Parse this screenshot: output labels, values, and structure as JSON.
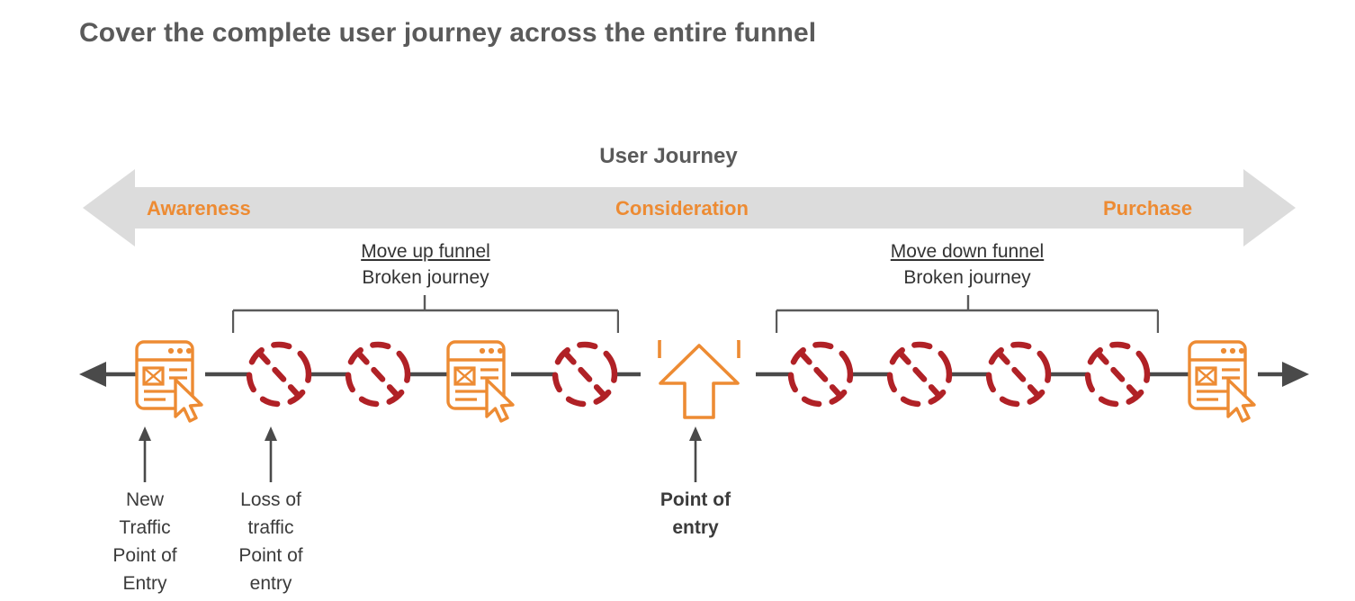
{
  "slide": {
    "title": "Cover the complete user journey across the entire funnel"
  },
  "journey": {
    "heading": "User Journey",
    "stages": [
      {
        "label": "Awareness"
      },
      {
        "label": "Consideration"
      },
      {
        "label": "Purchase"
      }
    ],
    "band_color": "#DCDCDC",
    "stage_label_color": "#ED8B33"
  },
  "brackets": [
    {
      "title": "Move up funnel",
      "subtitle": "Broken journey"
    },
    {
      "title": "Move down funnel",
      "subtitle": "Broken journey"
    }
  ],
  "timeline": {
    "line_color": "#4a4a4a",
    "webpage_icon_color": "#ED8B33",
    "broken_icon_color": "#B02126",
    "nodes": [
      {
        "type": "arrow-left-icon"
      },
      {
        "type": "webpage-cursor-icon"
      },
      {
        "type": "broken-journey-icon"
      },
      {
        "type": "broken-journey-icon"
      },
      {
        "type": "webpage-cursor-icon"
      },
      {
        "type": "broken-journey-icon"
      },
      {
        "type": "entry-point-arrow-icon"
      },
      {
        "type": "broken-journey-icon"
      },
      {
        "type": "broken-journey-icon"
      },
      {
        "type": "broken-journey-icon"
      },
      {
        "type": "broken-journey-icon"
      },
      {
        "type": "webpage-cursor-icon"
      },
      {
        "type": "arrow-right-icon"
      }
    ]
  },
  "callouts": [
    {
      "lines": "New\nTraffic\nPoint of\nEntry",
      "bold": false
    },
    {
      "lines": "Loss of\ntraffic\nPoint of\nentry",
      "bold": false
    },
    {
      "lines": "Point of\nentry",
      "bold": true
    }
  ]
}
